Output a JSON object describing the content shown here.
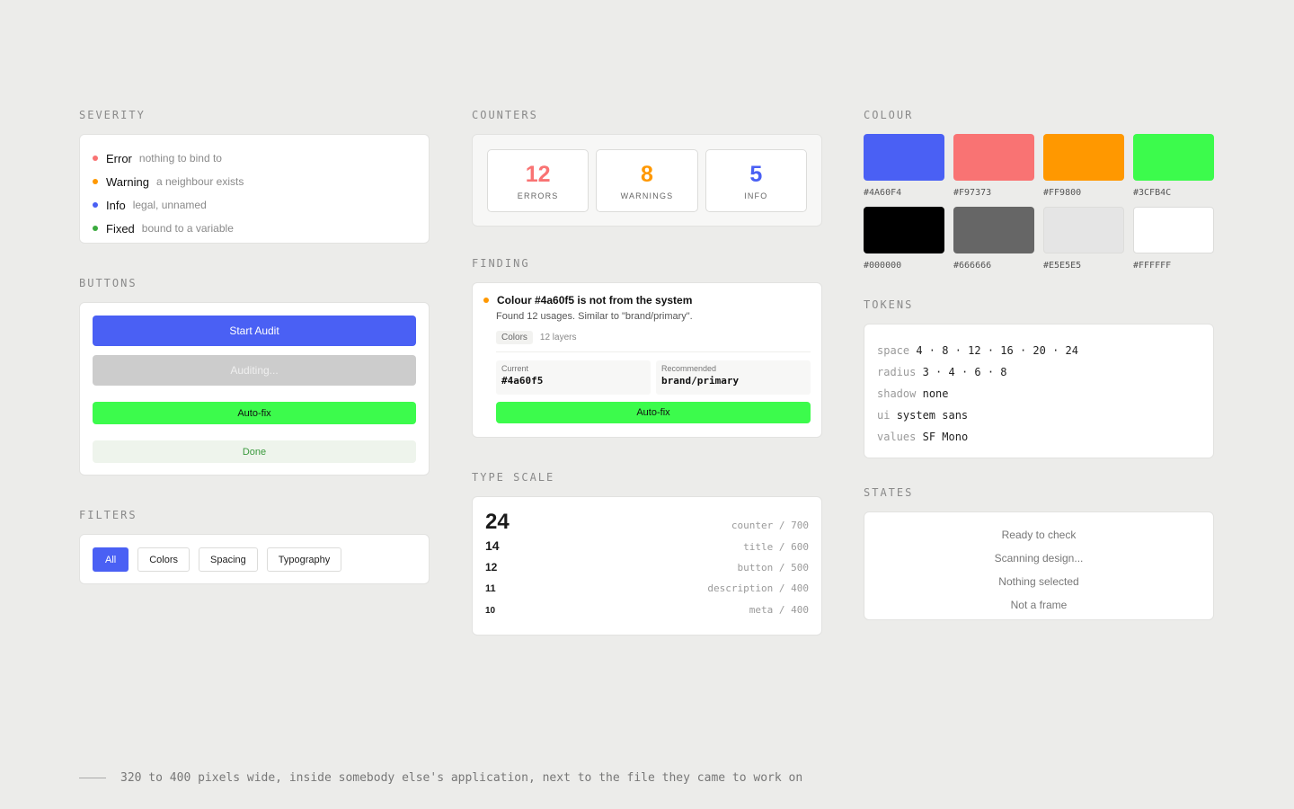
{
  "severity": {
    "label": "SEVERITY",
    "items": [
      {
        "name": "Error",
        "desc": "nothing to bind to",
        "color": "#F97373"
      },
      {
        "name": "Warning",
        "desc": "a neighbour exists",
        "color": "#FF9800"
      },
      {
        "name": "Info",
        "desc": "legal, unnamed",
        "color": "#4A60F4"
      },
      {
        "name": "Fixed",
        "desc": "bound to a variable",
        "color": "#3AAA3E"
      }
    ]
  },
  "buttons": {
    "label": "BUTTONS",
    "start": "Start Audit",
    "auditing": "Auditing...",
    "autofix": "Auto-fix",
    "done": "Done"
  },
  "filters": {
    "label": "FILTERS",
    "items": [
      "All",
      "Colors",
      "Spacing",
      "Typography"
    ],
    "active": "All"
  },
  "counters": {
    "label": "COUNTERS",
    "items": [
      {
        "value": "12",
        "label": "ERRORS",
        "color": "#F97373"
      },
      {
        "value": "8",
        "label": "WARNINGS",
        "color": "#FF9800"
      },
      {
        "value": "5",
        "label": "INFO",
        "color": "#4A60F4"
      }
    ]
  },
  "finding": {
    "label": "FINDING",
    "title": "Colour #4a60f5 is not from the system",
    "desc": "Found 12 usages. Similar to \"brand/primary\".",
    "tag": "Colors",
    "layers": "12 layers",
    "current_label": "Current",
    "current_value": "#4a60f5",
    "recommended_label": "Recommended",
    "recommended_value": "brand/primary",
    "button": "Auto-fix",
    "dot_color": "#FF9800"
  },
  "type_scale": {
    "label": "TYPE SCALE",
    "rows": [
      {
        "size": "24",
        "spec": "counter / 700"
      },
      {
        "size": "14",
        "spec": "title / 600"
      },
      {
        "size": "12",
        "spec": "button / 500"
      },
      {
        "size": "11",
        "spec": "description / 400"
      },
      {
        "size": "10",
        "spec": "meta / 400"
      }
    ]
  },
  "colour": {
    "label": "COLOUR",
    "swatches": [
      {
        "hex": "#4A60F4"
      },
      {
        "hex": "#F97373"
      },
      {
        "hex": "#FF9800"
      },
      {
        "hex": "#3CFB4C"
      },
      {
        "hex": "#000000"
      },
      {
        "hex": "#666666"
      },
      {
        "hex": "#E5E5E5"
      },
      {
        "hex": "#FFFFFF"
      }
    ]
  },
  "tokens": {
    "label": "TOKENS",
    "rows": [
      {
        "key": "space",
        "value": "4 · 8 · 12 · 16 · 20 · 24"
      },
      {
        "key": "radius",
        "value": "3 · 4 · 6 · 8"
      },
      {
        "key": "shadow",
        "value": "none"
      },
      {
        "key": "ui",
        "value": "system sans"
      },
      {
        "key": "values",
        "value": "SF Mono"
      }
    ]
  },
  "states": {
    "label": "STATES",
    "items": [
      "Ready to check",
      "Scanning design...",
      "Nothing selected",
      "Not a frame"
    ]
  },
  "footer": {
    "text": "320 to 400 pixels wide, inside somebody else's application, next to the file they came to work on"
  }
}
